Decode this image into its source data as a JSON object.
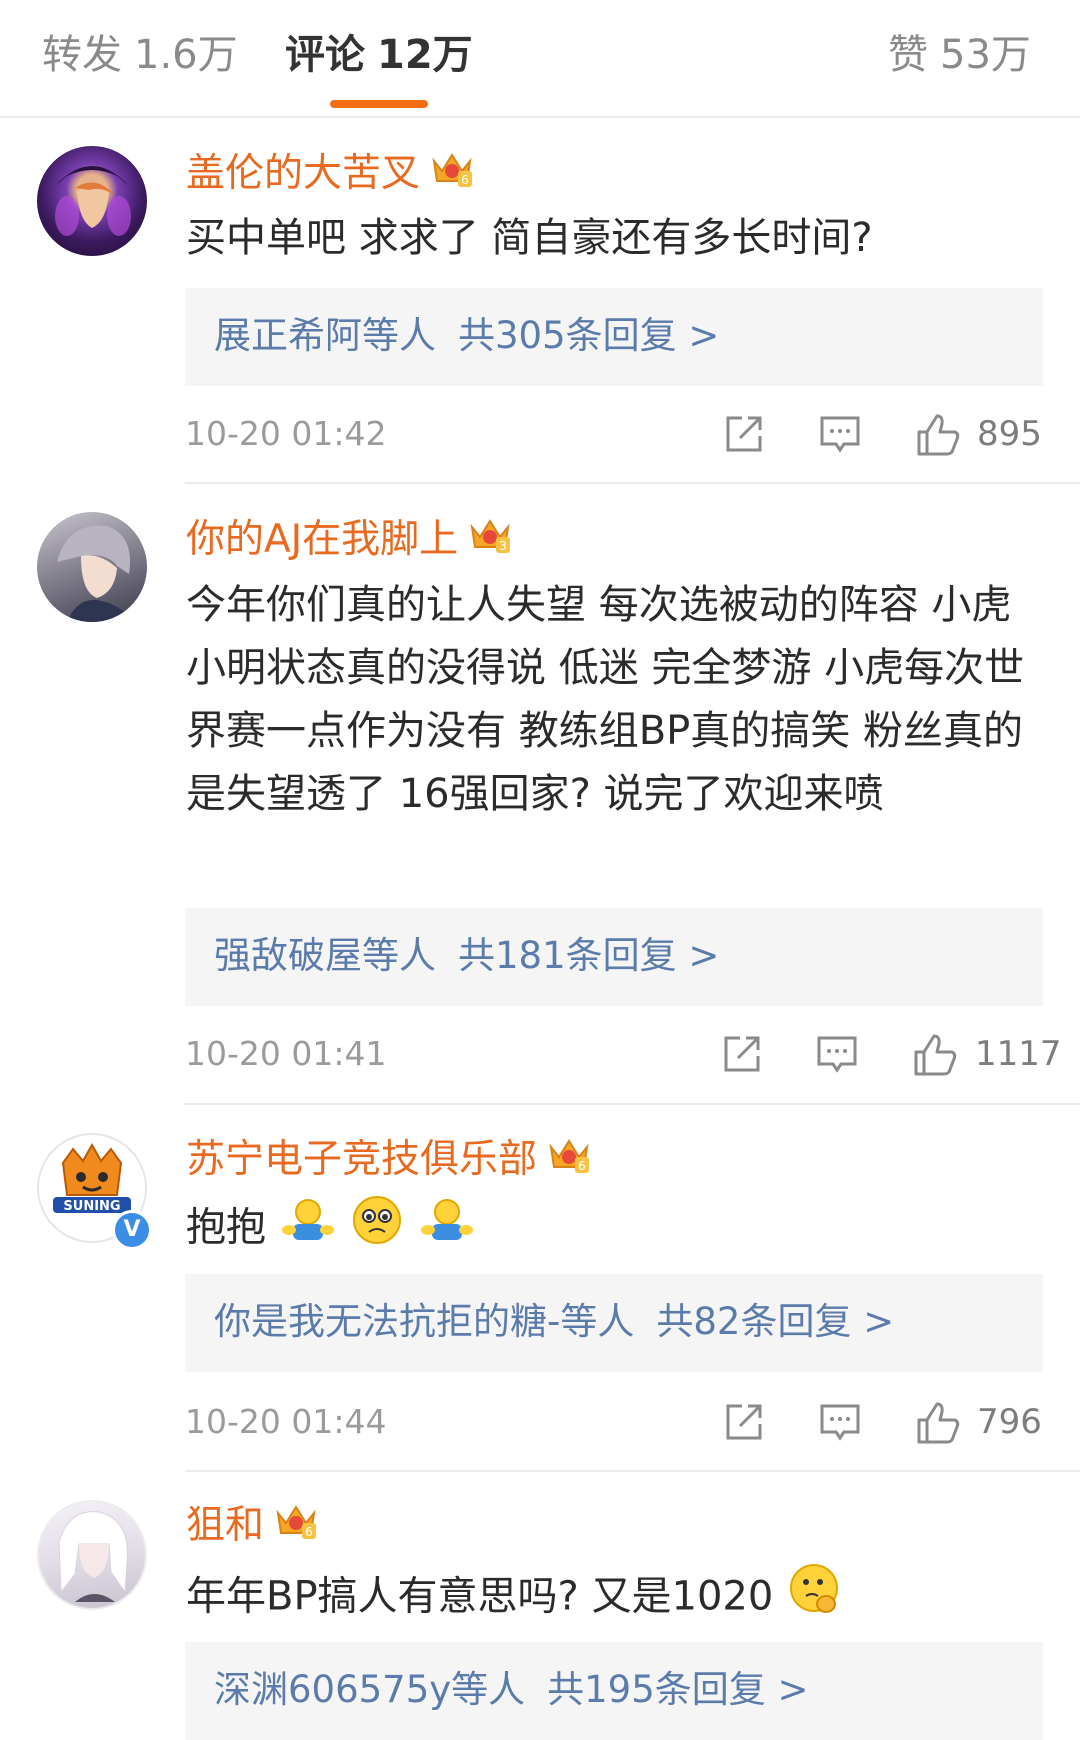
{
  "tabs": [
    {
      "label": "转发",
      "count": "1.6万"
    },
    {
      "label": "评论",
      "count": "12万"
    },
    {
      "label": "赞",
      "count": "53万"
    }
  ],
  "colors": {
    "accent": "#f56e16",
    "username": "#e86a21",
    "reply_link": "#5b7bab"
  },
  "comments": [
    {
      "username": "盖伦的大苦叉",
      "badge_level": "6",
      "text": "买中单吧 求求了 简自豪还有多长时间?",
      "reply_names": "展正希阿",
      "reply_suffix": "等人",
      "reply_count": "共305条回复 >",
      "time": "10-20 01:42",
      "likes": "895"
    },
    {
      "username": "你的AJ在我脚上",
      "badge_level": "3",
      "text": "今年你们真的让人失望 每次选被动的阵容 小虎小明状态真的没得说 低迷 完全梦游 小虎每次世界赛一点作为没有 教练组BP真的搞笑 粉丝真的是失望透了 16强回家? 说完了欢迎来喷",
      "reply_names": "强敌破屋",
      "reply_suffix": "等人",
      "reply_count": "共181条回复 >",
      "time": "10-20 01:41",
      "likes": "1117"
    },
    {
      "username": "苏宁电子竞技俱乐部",
      "badge_level": "6",
      "text": "抱抱",
      "avatar_label": "SUNING",
      "verified": "V",
      "reply_names": "你是我无法抗拒的糖-",
      "reply_suffix": "等人",
      "reply_count": "共82条回复 >",
      "time": "10-20 01:44",
      "likes": "796"
    },
    {
      "username": "狙和",
      "badge_level": "6",
      "text": "年年BP搞人有意思吗? 又是1020",
      "reply_names": "深渊606575y",
      "reply_suffix": "等人",
      "reply_count": "共195条回复 >"
    }
  ],
  "icons": {
    "share": "share-icon",
    "comment": "comment-icon",
    "like": "thumbs-up-icon",
    "badge": "crown-badge-icon"
  }
}
